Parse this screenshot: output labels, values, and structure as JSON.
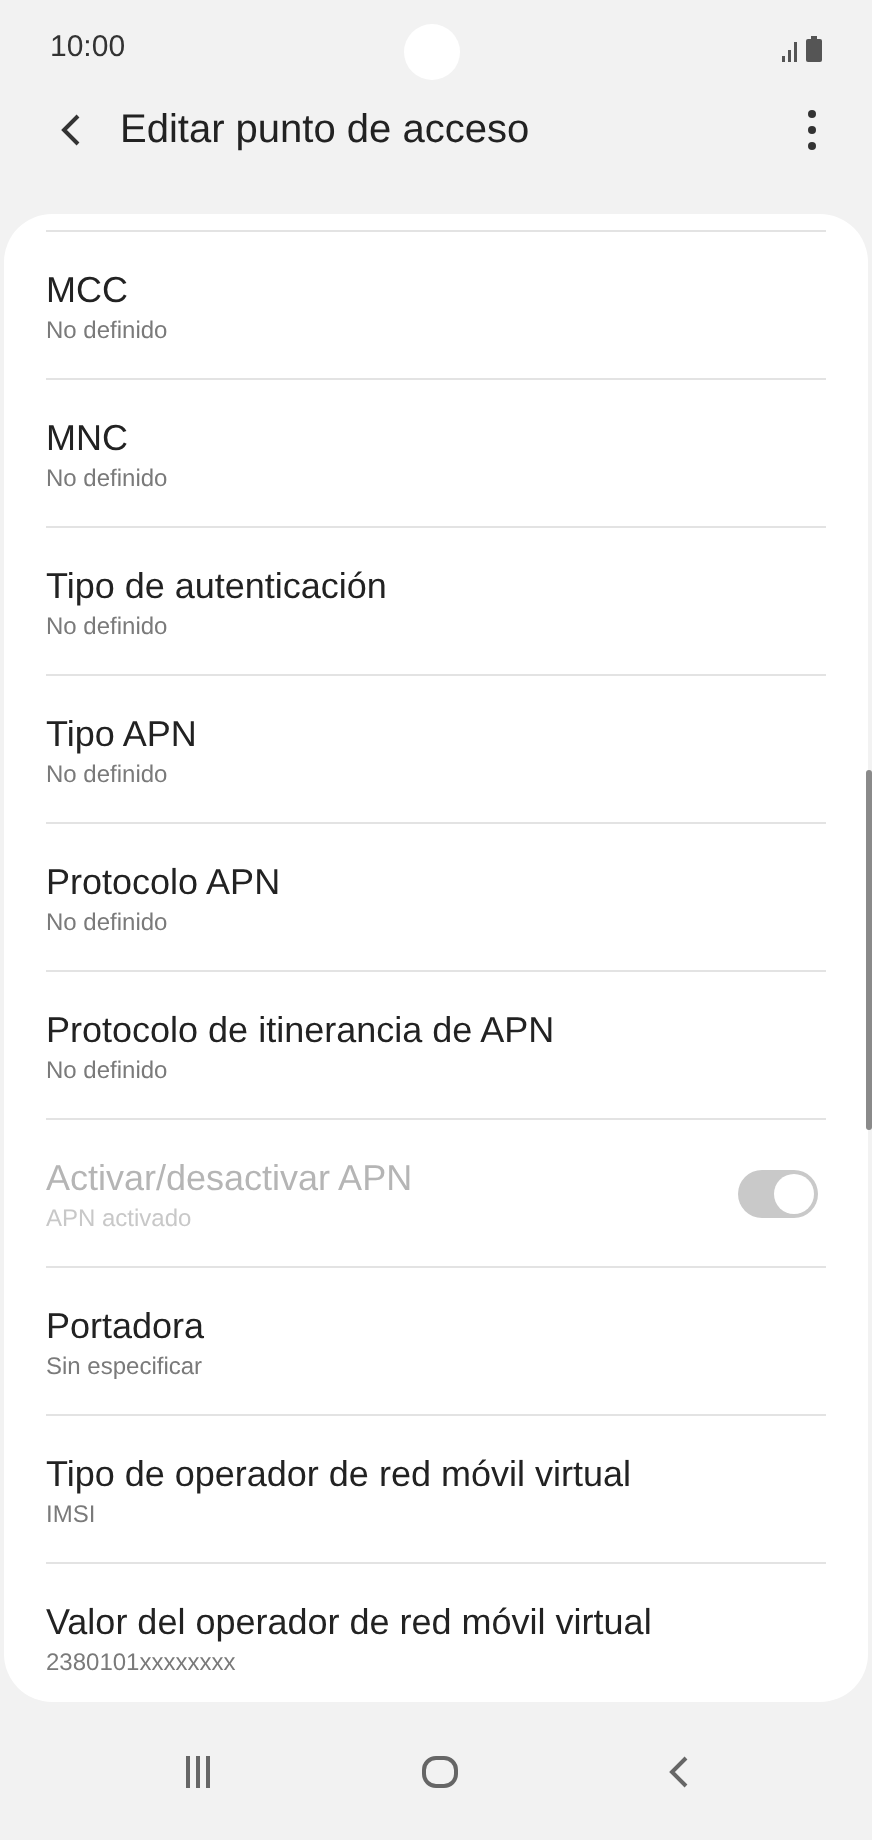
{
  "status_bar": {
    "time": "10:00"
  },
  "header": {
    "title": "Editar punto de acceso"
  },
  "settings": [
    {
      "kind": "text",
      "title": "MCC",
      "value": "No definido"
    },
    {
      "kind": "text",
      "title": "MNC",
      "value": "No definido"
    },
    {
      "kind": "text",
      "title": "Tipo de autenticación",
      "value": "No definido"
    },
    {
      "kind": "text",
      "title": "Tipo APN",
      "value": "No definido"
    },
    {
      "kind": "text",
      "title": "Protocolo APN",
      "value": "No definido"
    },
    {
      "kind": "text",
      "title": "Protocolo de itinerancia de APN",
      "value": "No definido"
    },
    {
      "kind": "switch",
      "title": "Activar/desactivar APN",
      "value": "APN activado",
      "disabled": true,
      "on": true
    },
    {
      "kind": "text",
      "title": "Portadora",
      "value": "Sin especificar"
    },
    {
      "kind": "text",
      "title": "Tipo de operador de red móvil virtual",
      "value": "IMSI"
    },
    {
      "kind": "text",
      "title": "Valor del operador de red móvil virtual",
      "value": "2380101xxxxxxxx"
    }
  ]
}
